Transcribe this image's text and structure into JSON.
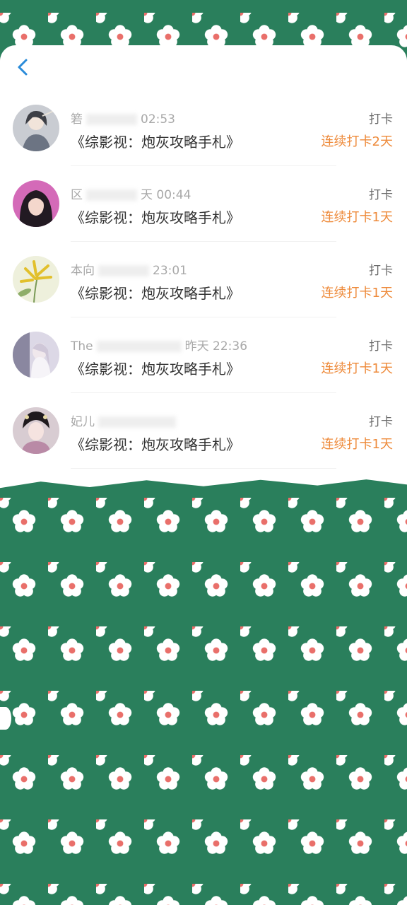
{
  "colors": {
    "pattern_green": "#2a7f5c",
    "flower_petal": "#ffffff",
    "flower_center": "#e96f6a",
    "streak_orange": "#ee8a3a",
    "back_blue": "#2a8bd9"
  },
  "header": {
    "back_icon": "chevron-left-icon"
  },
  "checkins": [
    {
      "user": "箬",
      "time": "02:53",
      "book": "《综影视：炮灰攻略手札》",
      "action": "打卡",
      "streak": "连续打卡2天"
    },
    {
      "user": "区",
      "time": "天 00:44",
      "book": "《综影视：炮灰攻略手札》",
      "action": "打卡",
      "streak": "连续打卡1天"
    },
    {
      "user": "本向",
      "time": "23:01",
      "book": "《综影视：炮灰攻略手札》",
      "action": "打卡",
      "streak": "连续打卡1天"
    },
    {
      "user": "The",
      "time": "昨天 22:36",
      "book": "《综影视：炮灰攻略手札》",
      "action": "打卡",
      "streak": "连续打卡1天"
    },
    {
      "user": "妃儿",
      "time": "",
      "book": "《综影视：炮灰攻略手札》",
      "action": "打卡",
      "streak": "连续打卡1天"
    }
  ]
}
